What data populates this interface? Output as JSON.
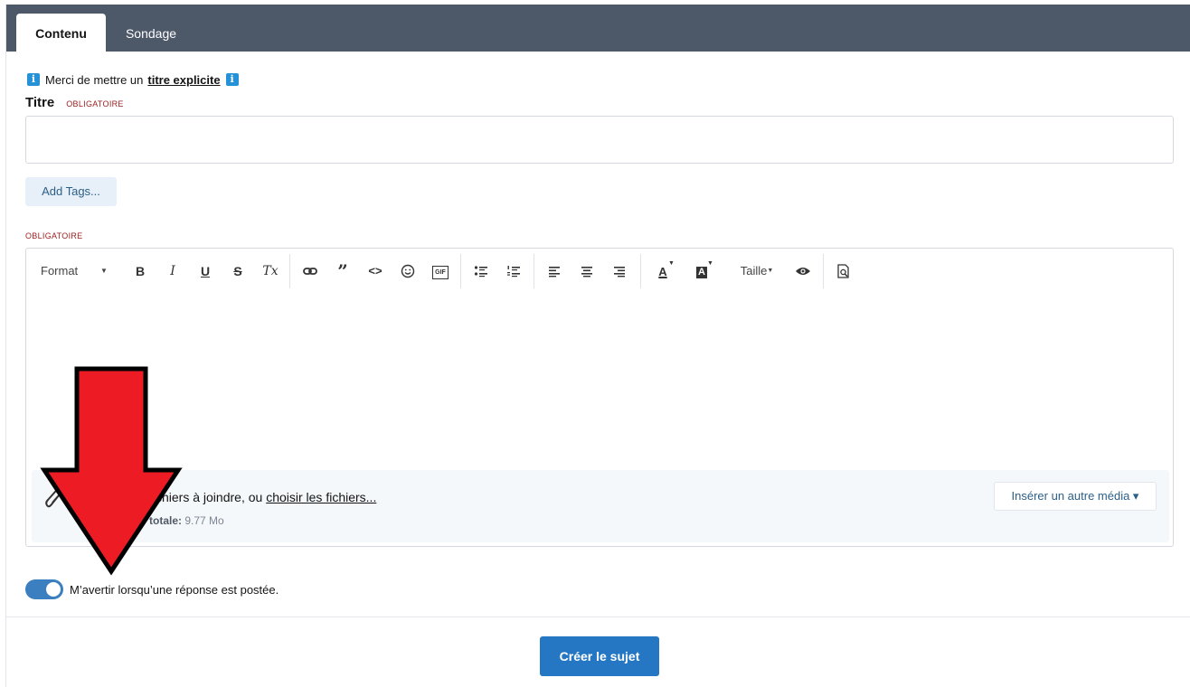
{
  "tabs": [
    {
      "label": "Contenu",
      "active": true
    },
    {
      "label": "Sondage",
      "active": false
    }
  ],
  "notice": {
    "prefix": "Merci de mettre un",
    "link": "titre explicite",
    "icon": "info-icon"
  },
  "title_field": {
    "label": "Titre",
    "required": "OBLIGATOIRE",
    "value": "",
    "placeholder": ""
  },
  "tags_button": "Add Tags...",
  "editor": {
    "required": "OBLIGATOIRE",
    "toolbar": {
      "format": "Format",
      "size": "Taille",
      "bold": "B",
      "italic": "I",
      "underline": "U",
      "strike": "S",
      "clear": "Tx",
      "color": "A",
      "bg_color": "A",
      "gif": "GIF"
    },
    "attachments": {
      "drop_text": "fichiers à joindre, ou",
      "choose_link": "choisir les fichiers...",
      "size_label": "ale totale:",
      "size_value": "9.77 Mo",
      "insert_media": "Insérer un autre média ▾"
    }
  },
  "notify": {
    "label": "M’avertir lorsqu’une réponse est postée.",
    "on": true
  },
  "submit": "Créer le sujet",
  "colors": {
    "tabbar": "#4d5869",
    "accent": "#2577c4",
    "required": "#9b1c1c",
    "arrow": "#ed1c24"
  }
}
